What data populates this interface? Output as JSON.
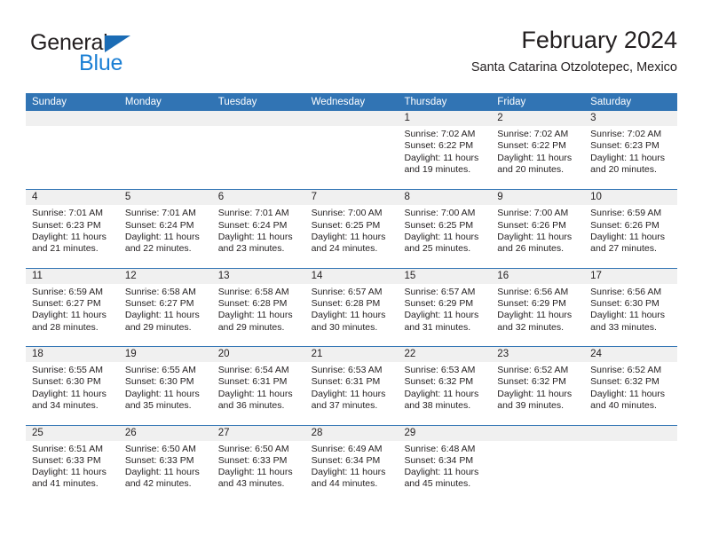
{
  "brand": {
    "name_top": "General",
    "name_bottom": "Blue",
    "triangle_icon": "brand-triangle-icon",
    "color_dark": "#231f20",
    "color_blue": "#1b7fd4"
  },
  "header": {
    "title": "February 2024",
    "subtitle": "Santa Catarina Otzolotepec, Mexico"
  },
  "theme": {
    "header_blue": "#3174b4",
    "band_gray": "#f0f0f0",
    "text": "#231f20"
  },
  "weekdays": [
    "Sunday",
    "Monday",
    "Tuesday",
    "Wednesday",
    "Thursday",
    "Friday",
    "Saturday"
  ],
  "weeks": [
    [
      {
        "day": "",
        "lines": []
      },
      {
        "day": "",
        "lines": []
      },
      {
        "day": "",
        "lines": []
      },
      {
        "day": "",
        "lines": []
      },
      {
        "day": "1",
        "lines": [
          "Sunrise: 7:02 AM",
          "Sunset: 6:22 PM",
          "Daylight: 11 hours",
          "and 19 minutes."
        ]
      },
      {
        "day": "2",
        "lines": [
          "Sunrise: 7:02 AM",
          "Sunset: 6:22 PM",
          "Daylight: 11 hours",
          "and 20 minutes."
        ]
      },
      {
        "day": "3",
        "lines": [
          "Sunrise: 7:02 AM",
          "Sunset: 6:23 PM",
          "Daylight: 11 hours",
          "and 20 minutes."
        ]
      }
    ],
    [
      {
        "day": "4",
        "lines": [
          "Sunrise: 7:01 AM",
          "Sunset: 6:23 PM",
          "Daylight: 11 hours",
          "and 21 minutes."
        ]
      },
      {
        "day": "5",
        "lines": [
          "Sunrise: 7:01 AM",
          "Sunset: 6:24 PM",
          "Daylight: 11 hours",
          "and 22 minutes."
        ]
      },
      {
        "day": "6",
        "lines": [
          "Sunrise: 7:01 AM",
          "Sunset: 6:24 PM",
          "Daylight: 11 hours",
          "and 23 minutes."
        ]
      },
      {
        "day": "7",
        "lines": [
          "Sunrise: 7:00 AM",
          "Sunset: 6:25 PM",
          "Daylight: 11 hours",
          "and 24 minutes."
        ]
      },
      {
        "day": "8",
        "lines": [
          "Sunrise: 7:00 AM",
          "Sunset: 6:25 PM",
          "Daylight: 11 hours",
          "and 25 minutes."
        ]
      },
      {
        "day": "9",
        "lines": [
          "Sunrise: 7:00 AM",
          "Sunset: 6:26 PM",
          "Daylight: 11 hours",
          "and 26 minutes."
        ]
      },
      {
        "day": "10",
        "lines": [
          "Sunrise: 6:59 AM",
          "Sunset: 6:26 PM",
          "Daylight: 11 hours",
          "and 27 minutes."
        ]
      }
    ],
    [
      {
        "day": "11",
        "lines": [
          "Sunrise: 6:59 AM",
          "Sunset: 6:27 PM",
          "Daylight: 11 hours",
          "and 28 minutes."
        ]
      },
      {
        "day": "12",
        "lines": [
          "Sunrise: 6:58 AM",
          "Sunset: 6:27 PM",
          "Daylight: 11 hours",
          "and 29 minutes."
        ]
      },
      {
        "day": "13",
        "lines": [
          "Sunrise: 6:58 AM",
          "Sunset: 6:28 PM",
          "Daylight: 11 hours",
          "and 29 minutes."
        ]
      },
      {
        "day": "14",
        "lines": [
          "Sunrise: 6:57 AM",
          "Sunset: 6:28 PM",
          "Daylight: 11 hours",
          "and 30 minutes."
        ]
      },
      {
        "day": "15",
        "lines": [
          "Sunrise: 6:57 AM",
          "Sunset: 6:29 PM",
          "Daylight: 11 hours",
          "and 31 minutes."
        ]
      },
      {
        "day": "16",
        "lines": [
          "Sunrise: 6:56 AM",
          "Sunset: 6:29 PM",
          "Daylight: 11 hours",
          "and 32 minutes."
        ]
      },
      {
        "day": "17",
        "lines": [
          "Sunrise: 6:56 AM",
          "Sunset: 6:30 PM",
          "Daylight: 11 hours",
          "and 33 minutes."
        ]
      }
    ],
    [
      {
        "day": "18",
        "lines": [
          "Sunrise: 6:55 AM",
          "Sunset: 6:30 PM",
          "Daylight: 11 hours",
          "and 34 minutes."
        ]
      },
      {
        "day": "19",
        "lines": [
          "Sunrise: 6:55 AM",
          "Sunset: 6:30 PM",
          "Daylight: 11 hours",
          "and 35 minutes."
        ]
      },
      {
        "day": "20",
        "lines": [
          "Sunrise: 6:54 AM",
          "Sunset: 6:31 PM",
          "Daylight: 11 hours",
          "and 36 minutes."
        ]
      },
      {
        "day": "21",
        "lines": [
          "Sunrise: 6:53 AM",
          "Sunset: 6:31 PM",
          "Daylight: 11 hours",
          "and 37 minutes."
        ]
      },
      {
        "day": "22",
        "lines": [
          "Sunrise: 6:53 AM",
          "Sunset: 6:32 PM",
          "Daylight: 11 hours",
          "and 38 minutes."
        ]
      },
      {
        "day": "23",
        "lines": [
          "Sunrise: 6:52 AM",
          "Sunset: 6:32 PM",
          "Daylight: 11 hours",
          "and 39 minutes."
        ]
      },
      {
        "day": "24",
        "lines": [
          "Sunrise: 6:52 AM",
          "Sunset: 6:32 PM",
          "Daylight: 11 hours",
          "and 40 minutes."
        ]
      }
    ],
    [
      {
        "day": "25",
        "lines": [
          "Sunrise: 6:51 AM",
          "Sunset: 6:33 PM",
          "Daylight: 11 hours",
          "and 41 minutes."
        ]
      },
      {
        "day": "26",
        "lines": [
          "Sunrise: 6:50 AM",
          "Sunset: 6:33 PM",
          "Daylight: 11 hours",
          "and 42 minutes."
        ]
      },
      {
        "day": "27",
        "lines": [
          "Sunrise: 6:50 AM",
          "Sunset: 6:33 PM",
          "Daylight: 11 hours",
          "and 43 minutes."
        ]
      },
      {
        "day": "28",
        "lines": [
          "Sunrise: 6:49 AM",
          "Sunset: 6:34 PM",
          "Daylight: 11 hours",
          "and 44 minutes."
        ]
      },
      {
        "day": "29",
        "lines": [
          "Sunrise: 6:48 AM",
          "Sunset: 6:34 PM",
          "Daylight: 11 hours",
          "and 45 minutes."
        ]
      },
      {
        "day": "",
        "lines": []
      },
      {
        "day": "",
        "lines": []
      }
    ]
  ]
}
